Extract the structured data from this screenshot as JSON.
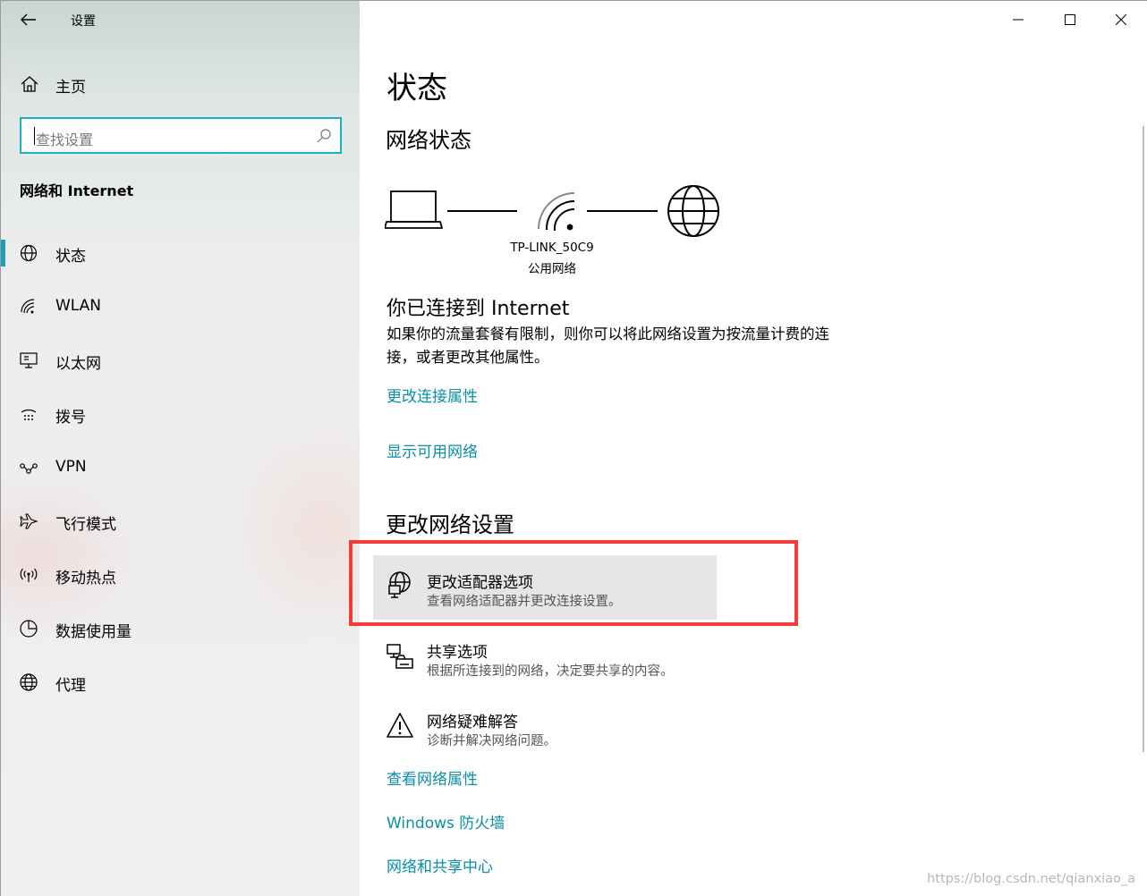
{
  "window": {
    "title": "设置"
  },
  "sidebar": {
    "home_label": "主页",
    "search_placeholder": "查找设置",
    "section_title": "网络和 Internet",
    "items": [
      {
        "label": "状态",
        "icon": "globe-icon",
        "selected": true
      },
      {
        "label": "WLAN",
        "icon": "wifi-icon"
      },
      {
        "label": "以太网",
        "icon": "ethernet-icon"
      },
      {
        "label": "拨号",
        "icon": "dialup-icon"
      },
      {
        "label": "VPN",
        "icon": "vpn-icon"
      },
      {
        "label": "飞行模式",
        "icon": "airplane-icon"
      },
      {
        "label": "移动热点",
        "icon": "hotspot-icon"
      },
      {
        "label": "数据使用量",
        "icon": "data-usage-icon"
      },
      {
        "label": "代理",
        "icon": "proxy-globe-icon"
      }
    ]
  },
  "main": {
    "page_title": "状态",
    "network_status_heading": "网络状态",
    "network_name": "TP-LINK_50C9",
    "network_type": "公用网络",
    "connected_title": "你已连接到 Internet",
    "connected_desc": "如果你的流量套餐有限制，则你可以将此网络设置为按流量计费的连接，或者更改其他属性。",
    "link_change_props": "更改连接属性",
    "link_show_networks": "显示可用网络",
    "change_settings_heading": "更改网络设置",
    "options": [
      {
        "title": "更改适配器选项",
        "desc": "查看网络适配器并更改连接设置。",
        "icon": "adapter-icon"
      },
      {
        "title": "共享选项",
        "desc": "根据所连接到的网络，决定要共享的内容。",
        "icon": "sharing-icon"
      },
      {
        "title": "网络疑难解答",
        "desc": "诊断并解决网络问题。",
        "icon": "warning-icon"
      }
    ],
    "link_view_props": "查看网络属性",
    "link_firewall": "Windows 防火墙",
    "link_sharing_center": "网络和共享中心"
  },
  "watermark": "https://blog.csdn.net/qianxiao_a",
  "colors": {
    "accent": "#1aa0b7",
    "link": "#0b8fa6",
    "highlight_box": "#f33b3b"
  }
}
